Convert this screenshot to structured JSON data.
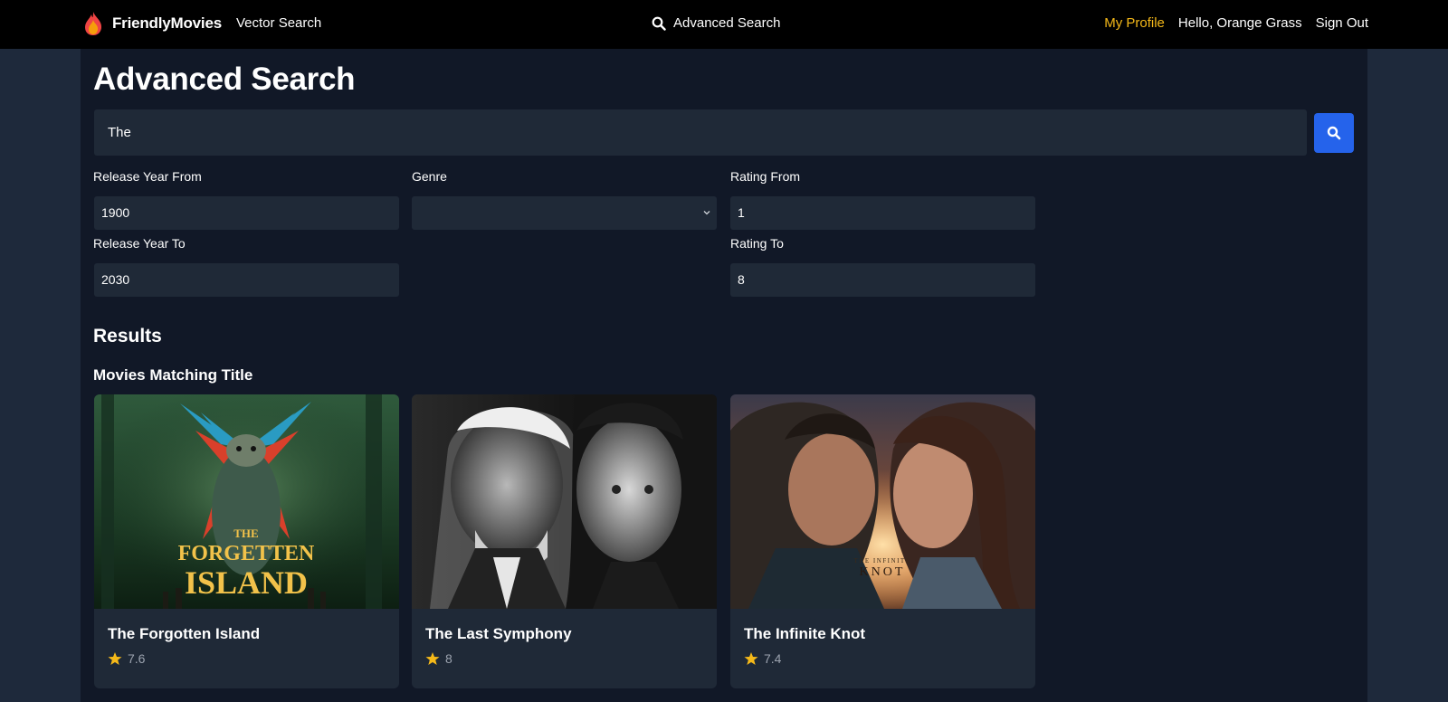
{
  "nav": {
    "brand": "FriendlyMovies",
    "vector_search": "Vector Search",
    "advanced_search": "Advanced Search",
    "my_profile": "My Profile",
    "greeting": "Hello, Orange Grass",
    "sign_out": "Sign Out"
  },
  "page": {
    "title": "Advanced Search"
  },
  "search": {
    "query": "The"
  },
  "filters": {
    "release_year_from": {
      "label": "Release Year From",
      "value": "1900"
    },
    "release_year_to": {
      "label": "Release Year To",
      "value": "2030"
    },
    "genre": {
      "label": "Genre",
      "value": ""
    },
    "rating_from": {
      "label": "Rating From",
      "value": "1"
    },
    "rating_to": {
      "label": "Rating To",
      "value": "8"
    }
  },
  "results": {
    "heading": "Results",
    "subheading": "Movies Matching Title",
    "movies": [
      {
        "title": "The Forgotten Island",
        "rating": "7.6",
        "poster_text_1": "THE",
        "poster_text_2": "FORGETTEN",
        "poster_text_3": "ISLAND"
      },
      {
        "title": "The Last Symphony",
        "rating": "8"
      },
      {
        "title": "The Infinite Knot",
        "rating": "7.4",
        "poster_text_1": "THE INFINITE",
        "poster_text_2": "KNOT"
      }
    ]
  },
  "colors": {
    "accent_profile": "#f5b919",
    "search_button": "#2563eb",
    "star": "#f5b919"
  }
}
